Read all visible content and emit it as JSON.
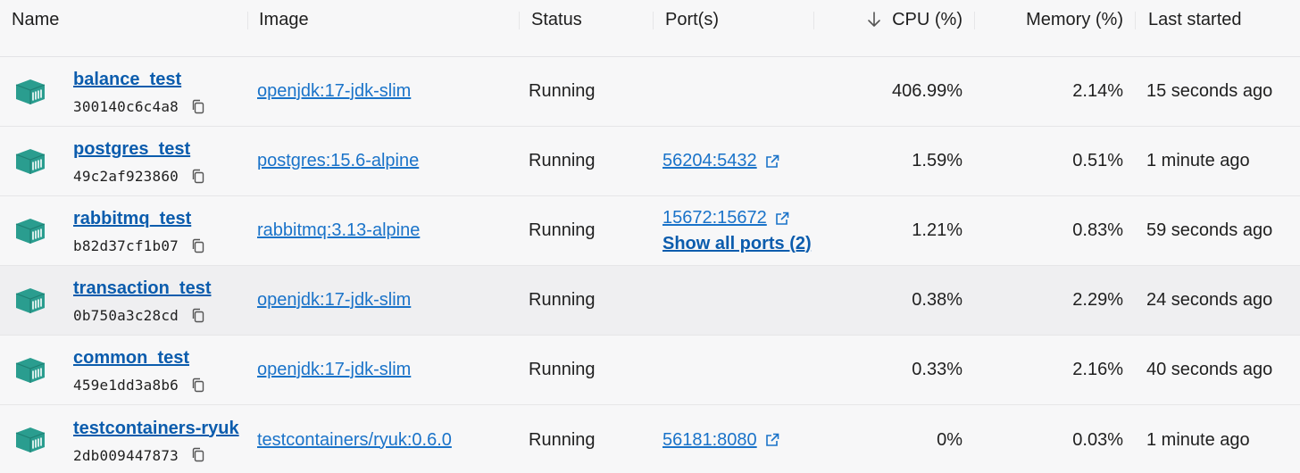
{
  "columns": {
    "name": "Name",
    "image": "Image",
    "status": "Status",
    "ports": "Port(s)",
    "cpu": "CPU (%)",
    "memory": "Memory (%)",
    "last_started": "Last started"
  },
  "sort": {
    "column": "cpu",
    "direction": "descending",
    "icon": "arrow-down-icon"
  },
  "colors": {
    "accent": "#0b5cad",
    "link": "#1a73c9",
    "container_icon": "#2a9d8f"
  },
  "containers": [
    {
      "name": "balance_test",
      "id": "300140c6c4a8",
      "image": "openjdk:17-jdk-slim",
      "status": "Running",
      "port": "",
      "extra_ports": "",
      "cpu": "406.99%",
      "memory": "2.14%",
      "last_started": "15 seconds ago"
    },
    {
      "name": "postgres_test",
      "id": "49c2af923860",
      "image": "postgres:15.6-alpine",
      "status": "Running",
      "port": "56204:5432",
      "extra_ports": "",
      "cpu": "1.59%",
      "memory": "0.51%",
      "last_started": "1 minute ago"
    },
    {
      "name": "rabbitmq_test",
      "id": "b82d37cf1b07",
      "image": "rabbitmq:3.13-alpine",
      "status": "Running",
      "port": "15672:15672",
      "extra_ports": "Show all ports (2)",
      "cpu": "1.21%",
      "memory": "0.83%",
      "last_started": "59 seconds ago"
    },
    {
      "name": "transaction_test",
      "id": "0b750a3c28cd",
      "image": "openjdk:17-jdk-slim",
      "status": "Running",
      "port": "",
      "extra_ports": "",
      "cpu": "0.38%",
      "memory": "2.29%",
      "last_started": "24 seconds ago"
    },
    {
      "name": "common_test",
      "id": "459e1dd3a8b6",
      "image": "openjdk:17-jdk-slim",
      "status": "Running",
      "port": "",
      "extra_ports": "",
      "cpu": "0.33%",
      "memory": "2.16%",
      "last_started": "40 seconds ago"
    },
    {
      "name": "testcontainers-ryuk",
      "id": "2db009447873",
      "image": "testcontainers/ryuk:0.6.0",
      "status": "Running",
      "port": "56181:8080",
      "extra_ports": "",
      "cpu": "0%",
      "memory": "0.03%",
      "last_started": "1 minute ago"
    }
  ]
}
